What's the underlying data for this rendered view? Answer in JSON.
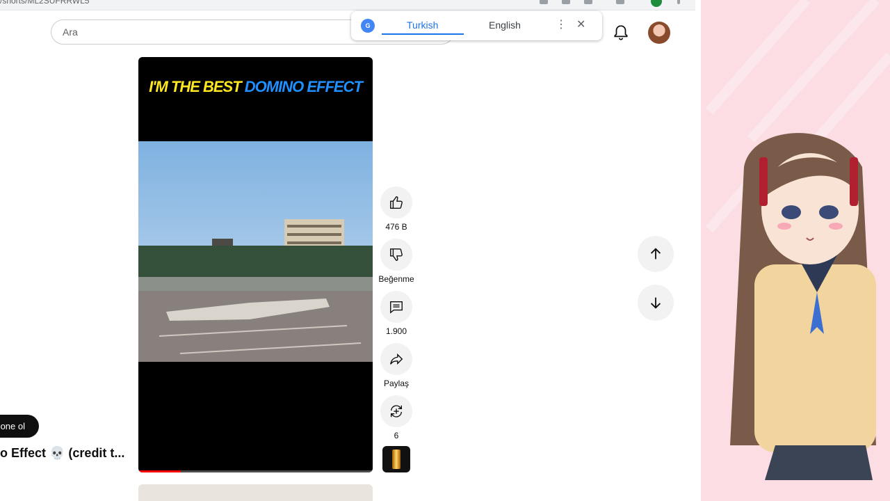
{
  "browser": {
    "url": "/shorts/ML2SUFRRWL5",
    "icons": [
      "translate-icon",
      "cast-icon",
      "bookmark-star-icon",
      "reading-mode-icon",
      "profile-icon",
      "kebab-menu-icon"
    ]
  },
  "search": {
    "placeholder": "Ara"
  },
  "translate": {
    "logo": "G",
    "tabs": [
      {
        "label": "Turkish",
        "active": true
      },
      {
        "label": "English",
        "active": false
      }
    ],
    "more_icon": "⋮",
    "close_icon": "✕"
  },
  "video": {
    "overlay_text_yellow": "I'M THE BEST ",
    "overlay_text_blue": "DOMINO EFFECT",
    "progress": 0.18
  },
  "actions": {
    "like": {
      "label": "476 B",
      "icon": "thumbs-up-icon"
    },
    "dislike": {
      "label": "Beğenme",
      "icon": "thumbs-down-icon"
    },
    "comments": {
      "label": "1.900",
      "icon": "comment-icon"
    },
    "share": {
      "label": "Paylaş",
      "icon": "share-icon"
    },
    "remix": {
      "label": "6",
      "icon": "remix-icon"
    }
  },
  "channel": {
    "subscribe_label": "one ol",
    "title": "o Effect 💀 (credit t..."
  },
  "colors": {
    "accent": "#1a73e8",
    "progress": "#ff0000",
    "panel_background": "#fbdde3"
  }
}
